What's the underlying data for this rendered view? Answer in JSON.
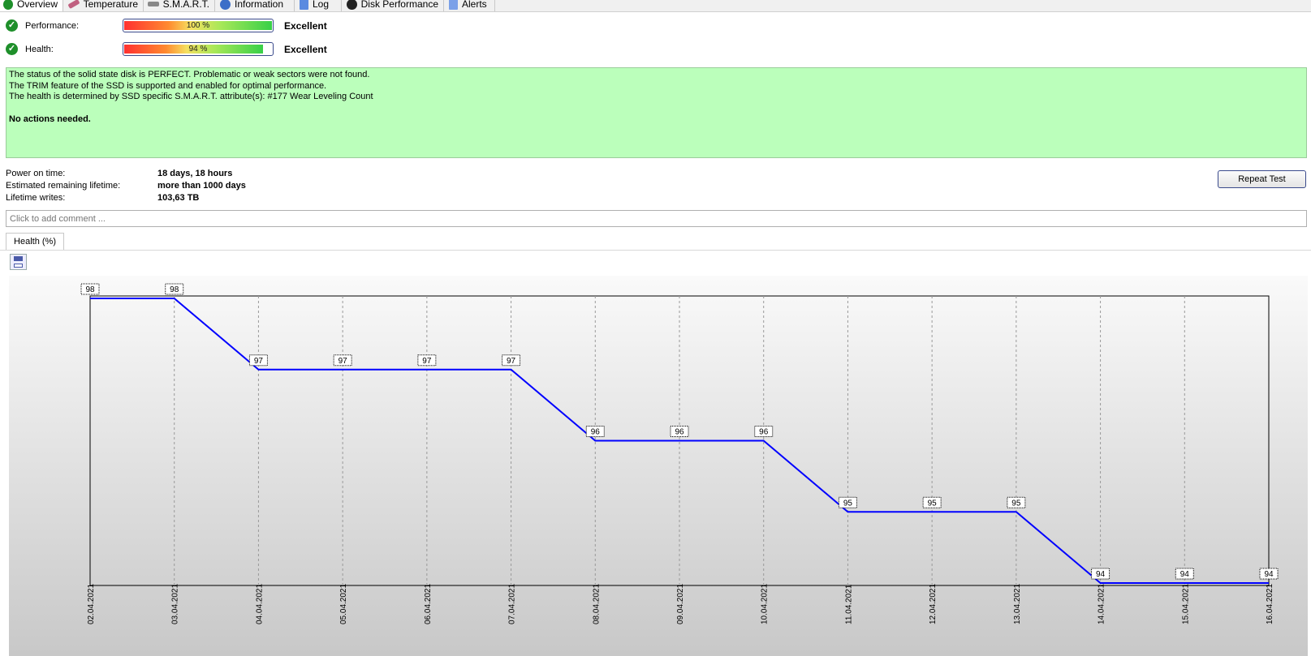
{
  "tabs": [
    {
      "label": "Overview",
      "icon": "check-icon"
    },
    {
      "label": "Temperature",
      "icon": "thermometer-icon"
    },
    {
      "label": "S.M.A.R.T.",
      "icon": "smart-drive-icon"
    },
    {
      "label": "Information",
      "icon": "info-icon"
    },
    {
      "label": "Log",
      "icon": "log-icon"
    },
    {
      "label": "Disk Performance",
      "icon": "speedometer-icon"
    },
    {
      "label": "Alerts",
      "icon": "alerts-icon"
    }
  ],
  "performance": {
    "label": "Performance:",
    "value": "100 %",
    "fraction": 1.0,
    "rating": "Excellent"
  },
  "health": {
    "label": "Health:",
    "value": "94 %",
    "fraction": 0.94,
    "rating": "Excellent"
  },
  "status_messages": [
    "The status of the solid state disk is PERFECT. Problematic or weak sectors were not found.",
    "The TRIM feature of the SSD is supported and enabled for optimal performance.",
    "The health is determined by SSD specific S.M.A.R.T. attribute(s):  #177 Wear Leveling Count"
  ],
  "status_action": "No actions needed.",
  "stats": [
    {
      "label": "Power on time:",
      "value": "18 days, 18 hours"
    },
    {
      "label": "Estimated remaining lifetime:",
      "value": "more than 1000 days"
    },
    {
      "label": "Lifetime writes:",
      "value": "103,63 TB"
    }
  ],
  "repeat_button": "Repeat Test",
  "comment_placeholder": "Click to add comment ...",
  "chart_tab": "Health (%)",
  "colors": {
    "status_bg": "#bbffbb",
    "line": "#0000ff",
    "check": "#1e8f2a"
  },
  "chart_data": {
    "type": "line",
    "categories": [
      "02.04.2021",
      "03.04.2021",
      "04.04.2021",
      "05.04.2021",
      "06.04.2021",
      "07.04.2021",
      "08.04.2021",
      "09.04.2021",
      "10.04.2021",
      "11.04.2021",
      "12.04.2021",
      "13.04.2021",
      "14.04.2021",
      "15.04.2021",
      "16.04.2021"
    ],
    "values": [
      98,
      98,
      97,
      97,
      97,
      97,
      96,
      96,
      96,
      95,
      95,
      95,
      94,
      94,
      94
    ],
    "ylim": [
      94,
      98
    ],
    "grid": "vertical dashed"
  }
}
